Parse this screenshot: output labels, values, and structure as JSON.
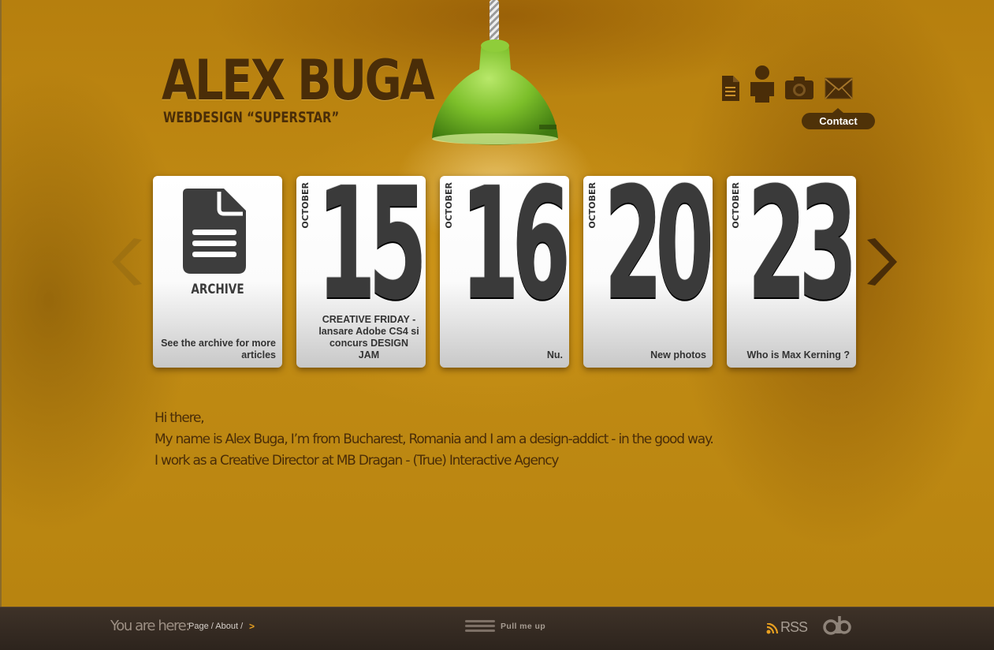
{
  "header": {
    "title": "ALEX BUGA",
    "subtitle": "WEBDESIGN “SUPERSTAR”"
  },
  "nav": {
    "icons": [
      "document-icon",
      "person-icon",
      "camera-icon",
      "mail-icon"
    ],
    "tooltip": "Contact"
  },
  "cards": [
    {
      "type": "archive",
      "label": "ARCHIVE",
      "caption": "See the archive for more articles"
    },
    {
      "month": "OCTOBER",
      "day": "15",
      "caption": "CREATIVE FRIDAY - lansare Adobe CS4 si concurs DESIGN JAM"
    },
    {
      "month": "OCTOBER",
      "day": "16",
      "caption": "Nu."
    },
    {
      "month": "OCTOBER",
      "day": "20",
      "caption": "New photos"
    },
    {
      "month": "OCTOBER",
      "day": "23",
      "caption": "Who is Max Kerning ?"
    }
  ],
  "intro": {
    "line1": "Hi there,",
    "line2": "My name is Alex Buga, I’m from Bucharest, Romania and I am a design-addict - in the good way.",
    "line3": "I work as a Creative Director at MB Dragan - (True) Interactive Agency"
  },
  "footer": {
    "you_are_here": "You are here:",
    "crumb_page": "Page",
    "crumb_sep": "/",
    "crumb_about": "About",
    "crumb_sep2": "/",
    "crumb_arrow": ">",
    "pull_label": "Pull me up",
    "rss_label": "RSS"
  },
  "colors": {
    "background": "#b98510",
    "text_brown": "#4a2d08",
    "footer": "#2d241d",
    "lamp_green": "#7cbf2a",
    "accent_orange": "#e8a020"
  }
}
